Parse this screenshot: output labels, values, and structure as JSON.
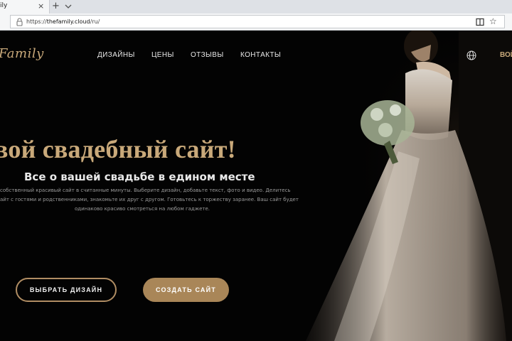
{
  "browser": {
    "tab_title": "ily",
    "tab_close": "×",
    "new_tab": "+",
    "url_scheme": "https://",
    "url_host": "thefamily.cloud",
    "url_path": "/ru/"
  },
  "site": {
    "logo": "Family",
    "nav": [
      {
        "label": "ДИЗАЙНЫ"
      },
      {
        "label": "ЦЕНЫ"
      },
      {
        "label": "ОТЗЫВЫ"
      },
      {
        "label": "КОНТАКТЫ"
      }
    ],
    "login": "ВОЙ",
    "hero": {
      "title": "вой свадебный сайт!",
      "subtitle": "Все о вашей свадьбе в едином месте",
      "description": [
        "собственный красивый сайт в считанные минуты. Выберите дизайн, добавьте текст, фото и видео. Делитесь",
        "айт с гостями и родственниками, знакомьте их друг с другом. Готовьтесь к торжеству заранее. Ваш сайт будет",
        "одинаково красиво смотреться на любом гаджете."
      ]
    },
    "buttons": {
      "choose_design": "ВЫБРАТЬ ДИЗАЙН",
      "create_site": "СОЗДАТЬ САЙТ"
    }
  },
  "colors": {
    "accent_gold": "#c9a97a",
    "button_fill": "#a98658",
    "background": "#030303"
  }
}
